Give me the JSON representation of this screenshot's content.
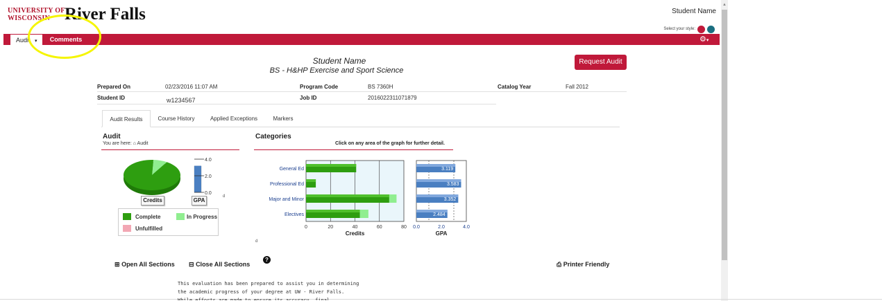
{
  "header": {
    "logo_line1": "UNIVERSITY OF",
    "logo_line2": "WISCONSIN",
    "logo_campus": "River Falls",
    "user_name": "Student Name",
    "style_label": "Select your style:",
    "style_colors": [
      "#c0193a",
      "#1a6e80"
    ]
  },
  "nav": {
    "audit_tab": "Audit",
    "comments_tab": "Comments",
    "accent": "#c0193a",
    "highlight_color": "#f5f500"
  },
  "audit": {
    "student_name": "Student Name",
    "program": "BS - H&HP Exercise and Sport Science",
    "request_button": "Request Audit",
    "fields": {
      "prepared_on_label": "Prepared On",
      "prepared_on": "02/23/2016 11:07 AM",
      "program_code_label": "Program Code",
      "program_code": "BS 7360H",
      "catalog_year_label": "Catalog Year",
      "catalog_year": "Fall 2012",
      "student_id_label": "Student ID",
      "student_id": "w1234567",
      "job_id_label": "Job ID",
      "job_id": "2016022311071879"
    }
  },
  "subtabs": [
    "Audit Results",
    "Course History",
    "Applied Exceptions",
    "Markers"
  ],
  "results": {
    "audit_heading": "Audit",
    "breadcrumb_prefix": "You are here:",
    "breadcrumb_item": "Audit",
    "categories_heading": "Categories",
    "click_hint": "Click on any area of the graph for further detail.",
    "credits_button": "Credits",
    "gpa_button": "GPA",
    "gpa_ticks": [
      "4.0",
      "2.0",
      "0.0"
    ],
    "stray_mark_1": "d",
    "stray_mark_2": "d",
    "legend": {
      "complete": "Complete",
      "in_progress": "In Progress",
      "unfulfilled": "Unfulfilled",
      "complete_color": "#2e9e10",
      "in_progress_color": "#90ee90",
      "unfulfilled_color": "#f2a7b4"
    }
  },
  "chart_data": [
    {
      "type": "pie",
      "labels": [
        "Complete",
        "In Progress"
      ],
      "values": [
        92,
        8
      ]
    },
    {
      "type": "bar",
      "orientation": "horizontal",
      "categories": [
        "General Ed",
        "Professional Ed",
        "Major and Minor",
        "Electives"
      ],
      "series": [
        {
          "name": "Complete",
          "values": [
            41,
            8,
            68,
            44
          ]
        },
        {
          "name": "In Progress",
          "values": [
            0,
            0,
            6,
            7
          ]
        }
      ],
      "xlabel": "Credits",
      "xlim": [
        0,
        80
      ],
      "xticks": [
        "0",
        "20",
        "40",
        "60",
        "80"
      ]
    },
    {
      "type": "bar",
      "orientation": "horizontal",
      "categories": [
        "General Ed",
        "Professional Ed",
        "Major and Minor",
        "Electives"
      ],
      "values": [
        3.119,
        3.583,
        3.352,
        2.484
      ],
      "value_labels": [
        "3.119",
        "3.583",
        "3.352",
        "2.484"
      ],
      "xlabel": "GPA",
      "xlim": [
        0,
        4
      ],
      "xticks": [
        "0.0",
        "2.0",
        "4.0"
      ]
    }
  ],
  "actions": {
    "open_all": "Open All Sections",
    "close_all": "Close All Sections",
    "printer": "Printer Friendly"
  },
  "disclaimer": [
    "This evaluation has been prepared to assist you in determining",
    "the academic progress of your degree at UW - River Falls.",
    "While efforts are made to ensure its accuracy, final"
  ]
}
